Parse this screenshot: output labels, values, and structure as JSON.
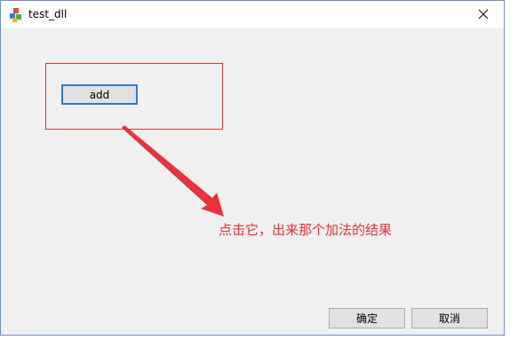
{
  "window": {
    "title": "test_dll",
    "app_icon": "colored-cubes-icon",
    "close_icon": "close-icon"
  },
  "main": {
    "add_label": "add",
    "annotation": "点击它，出来那个加法的结果"
  },
  "footer": {
    "ok_label": "确定",
    "cancel_label": "取消"
  },
  "colors": {
    "annotation_red": "#e8323c",
    "focus_blue": "#2d7bd1",
    "dialog_bg": "#f0f0f0"
  }
}
